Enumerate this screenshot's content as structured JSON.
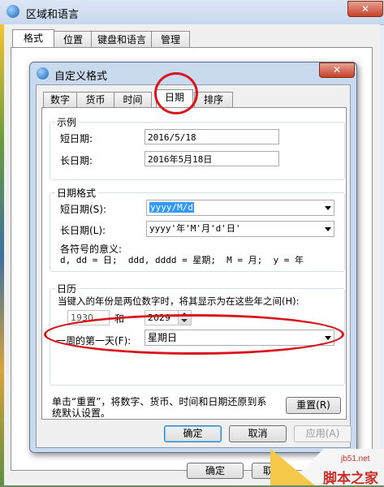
{
  "outer": {
    "title": "区域和语言",
    "tabs": [
      "格式",
      "位置",
      "键盘和语言",
      "管理"
    ],
    "bottom_ok": "确定",
    "bottom_cancel": "取"
  },
  "dialog": {
    "title": "自定义格式",
    "tabs": [
      "数字",
      "货币",
      "时间",
      "日期",
      "排序"
    ],
    "example": {
      "group_label": "示例",
      "short_label": "短日期:",
      "short_value": "2016/5/18",
      "long_label": "长日期:",
      "long_value": "2016年5月18日"
    },
    "format": {
      "group_label": "日期格式",
      "short_label": "短日期(S):",
      "short_value": "yyyy/M/d",
      "long_label": "长日期(L):",
      "long_value": "yyyy'年'M'月'd'日'",
      "symbols_title": "各符号的意义:",
      "symbols_text": "d, dd = 日;  ddd, dddd = 星期;  M = 月;  y = 年"
    },
    "calendar": {
      "group_label": "日历",
      "two_digit_text": "当键入的年份是两位数字时，将其显示为在这些年之间(H):",
      "year_from": "1930",
      "and_label": "和",
      "year_to": "2029",
      "first_day_label": "一周的第一天(F):",
      "first_day_value": "星期日"
    },
    "reset_text_line1": "单击“重置”，将数字、货币、时间和日期还原到系",
    "reset_text_line2": "统默认设置。",
    "reset_button": "重置(R)",
    "ok_button": "确定",
    "cancel_button": "取消",
    "apply_button": "应用(A)"
  },
  "watermark": {
    "url": "jb51.net",
    "name": "脚本之家"
  },
  "colors": {
    "highlight": "#d8141c",
    "selection": "#3399ff"
  }
}
